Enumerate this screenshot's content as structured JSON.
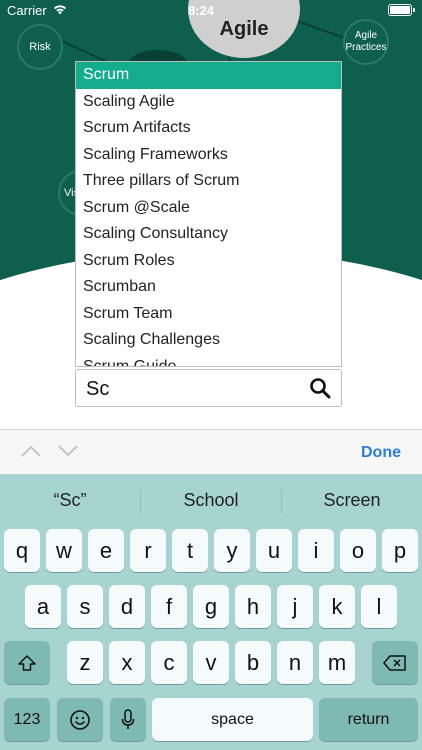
{
  "status_bar": {
    "carrier": "Carrier",
    "time": "8:24"
  },
  "mindmap": {
    "center": "Agile",
    "nodes": [
      "Risk",
      "Agile\nPractices",
      "Vis"
    ]
  },
  "dropdown": {
    "items": [
      "Scrum",
      "Scaling Agile",
      "Scrum Artifacts",
      "Scaling Frameworks",
      "Three pillars of Scrum",
      "Scrum @Scale",
      "Scaling Consultancy",
      "Scrum Roles",
      "Scrumban",
      "Scrum Team",
      "Scaling Challenges",
      "Scrum Guide"
    ],
    "selected_index": 0,
    "selected_color": "#13ad8d"
  },
  "search": {
    "value": "Sc"
  },
  "accessory": {
    "done_label": "Done"
  },
  "keyboard": {
    "suggestions": [
      "“Sc”",
      "School",
      "Screen"
    ],
    "row1": [
      "q",
      "w",
      "e",
      "r",
      "t",
      "y",
      "u",
      "i",
      "o",
      "p"
    ],
    "row2": [
      "a",
      "s",
      "d",
      "f",
      "g",
      "h",
      "j",
      "k",
      "l"
    ],
    "row3": [
      "z",
      "x",
      "c",
      "v",
      "b",
      "n",
      "m"
    ],
    "numbers_label": "123",
    "space_label": "space",
    "return_label": "return"
  },
  "colors": {
    "background_top": "#0f5f4f",
    "keyboard": "#a7d4d0",
    "done": "#2b7ed8"
  }
}
